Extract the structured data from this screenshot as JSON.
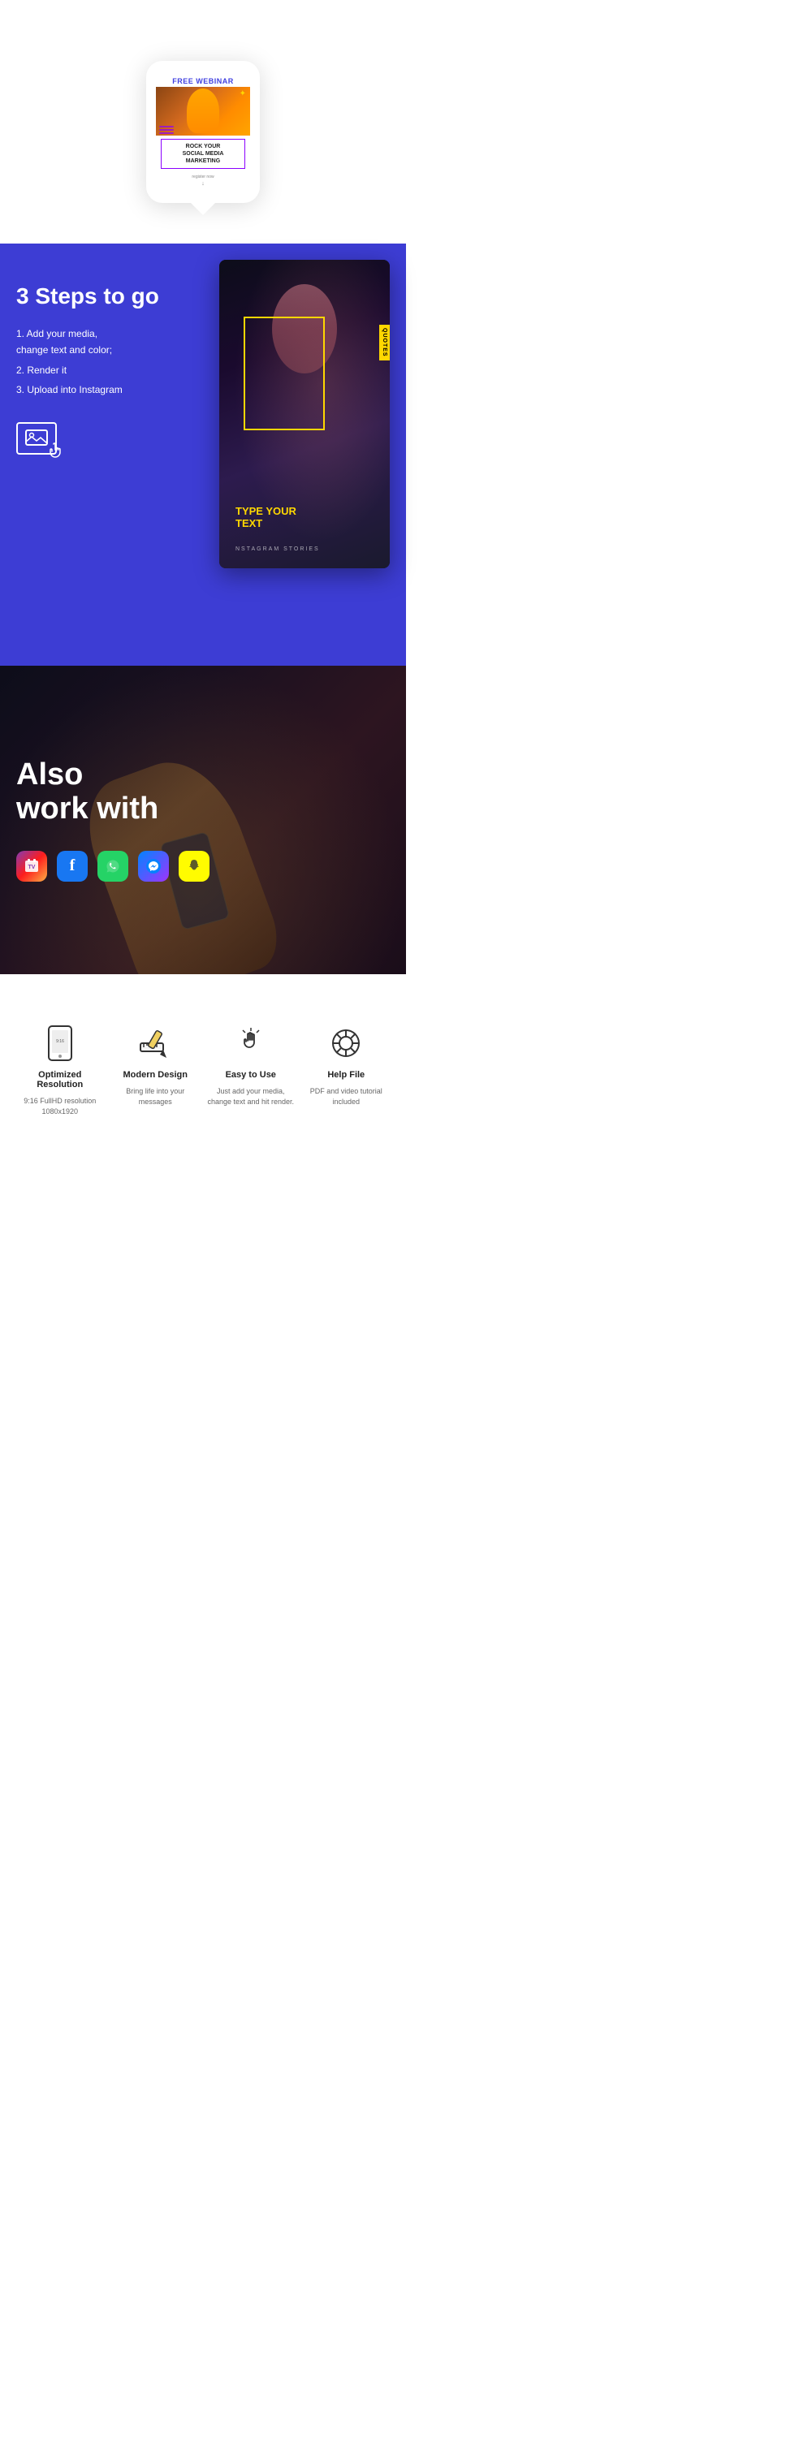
{
  "phone_section": {
    "webinar_label": "FREE WEBINAR",
    "title_line1": "ROCK YOUR",
    "title_line2": "SOCIAL MEDIA",
    "title_line3": "MARKETING",
    "register_text": "register now",
    "arrow": "↓"
  },
  "steps_section": {
    "title": "3 Steps to go",
    "steps": [
      "1. Add your media,\n   change text and color;",
      "2. Render it",
      "3. Upload into Instagram"
    ],
    "step1": "1.  Add your media,",
    "step1b": "    change text and color;",
    "step2": "2.  Render it",
    "step3": "3.  Upload into Instagram",
    "card_main_text": "TYPE YOUR\nTEXT",
    "card_text_line1": "TYPE YOUR",
    "card_text_line2": "TEXT",
    "card_subtitle": "NSTAGRAM STORIES",
    "quotes_badge": "QUOTES"
  },
  "dark_section": {
    "title_line1": "Also",
    "title_line2": "work with"
  },
  "social_icons": [
    {
      "name": "IGTV",
      "type": "igtv"
    },
    {
      "name": "Facebook",
      "type": "fb"
    },
    {
      "name": "WhatsApp",
      "type": "whatsapp"
    },
    {
      "name": "Messenger",
      "type": "messenger"
    },
    {
      "name": "Snapchat",
      "type": "snapchat"
    }
  ],
  "features": [
    {
      "icon": "phone",
      "name": "Optimized Resolution",
      "desc": "9:16 FullHD resolution\n1080x1920"
    },
    {
      "icon": "pencil",
      "name": "Modern Design",
      "desc": "Bring life into your\nmessages"
    },
    {
      "icon": "hand",
      "name": "Easy to Use",
      "desc": "Just add your media,\nchange text\nand hit render."
    },
    {
      "icon": "lifebuoy",
      "name": "Help File",
      "desc": "PDF and video\ntutorial included"
    }
  ]
}
